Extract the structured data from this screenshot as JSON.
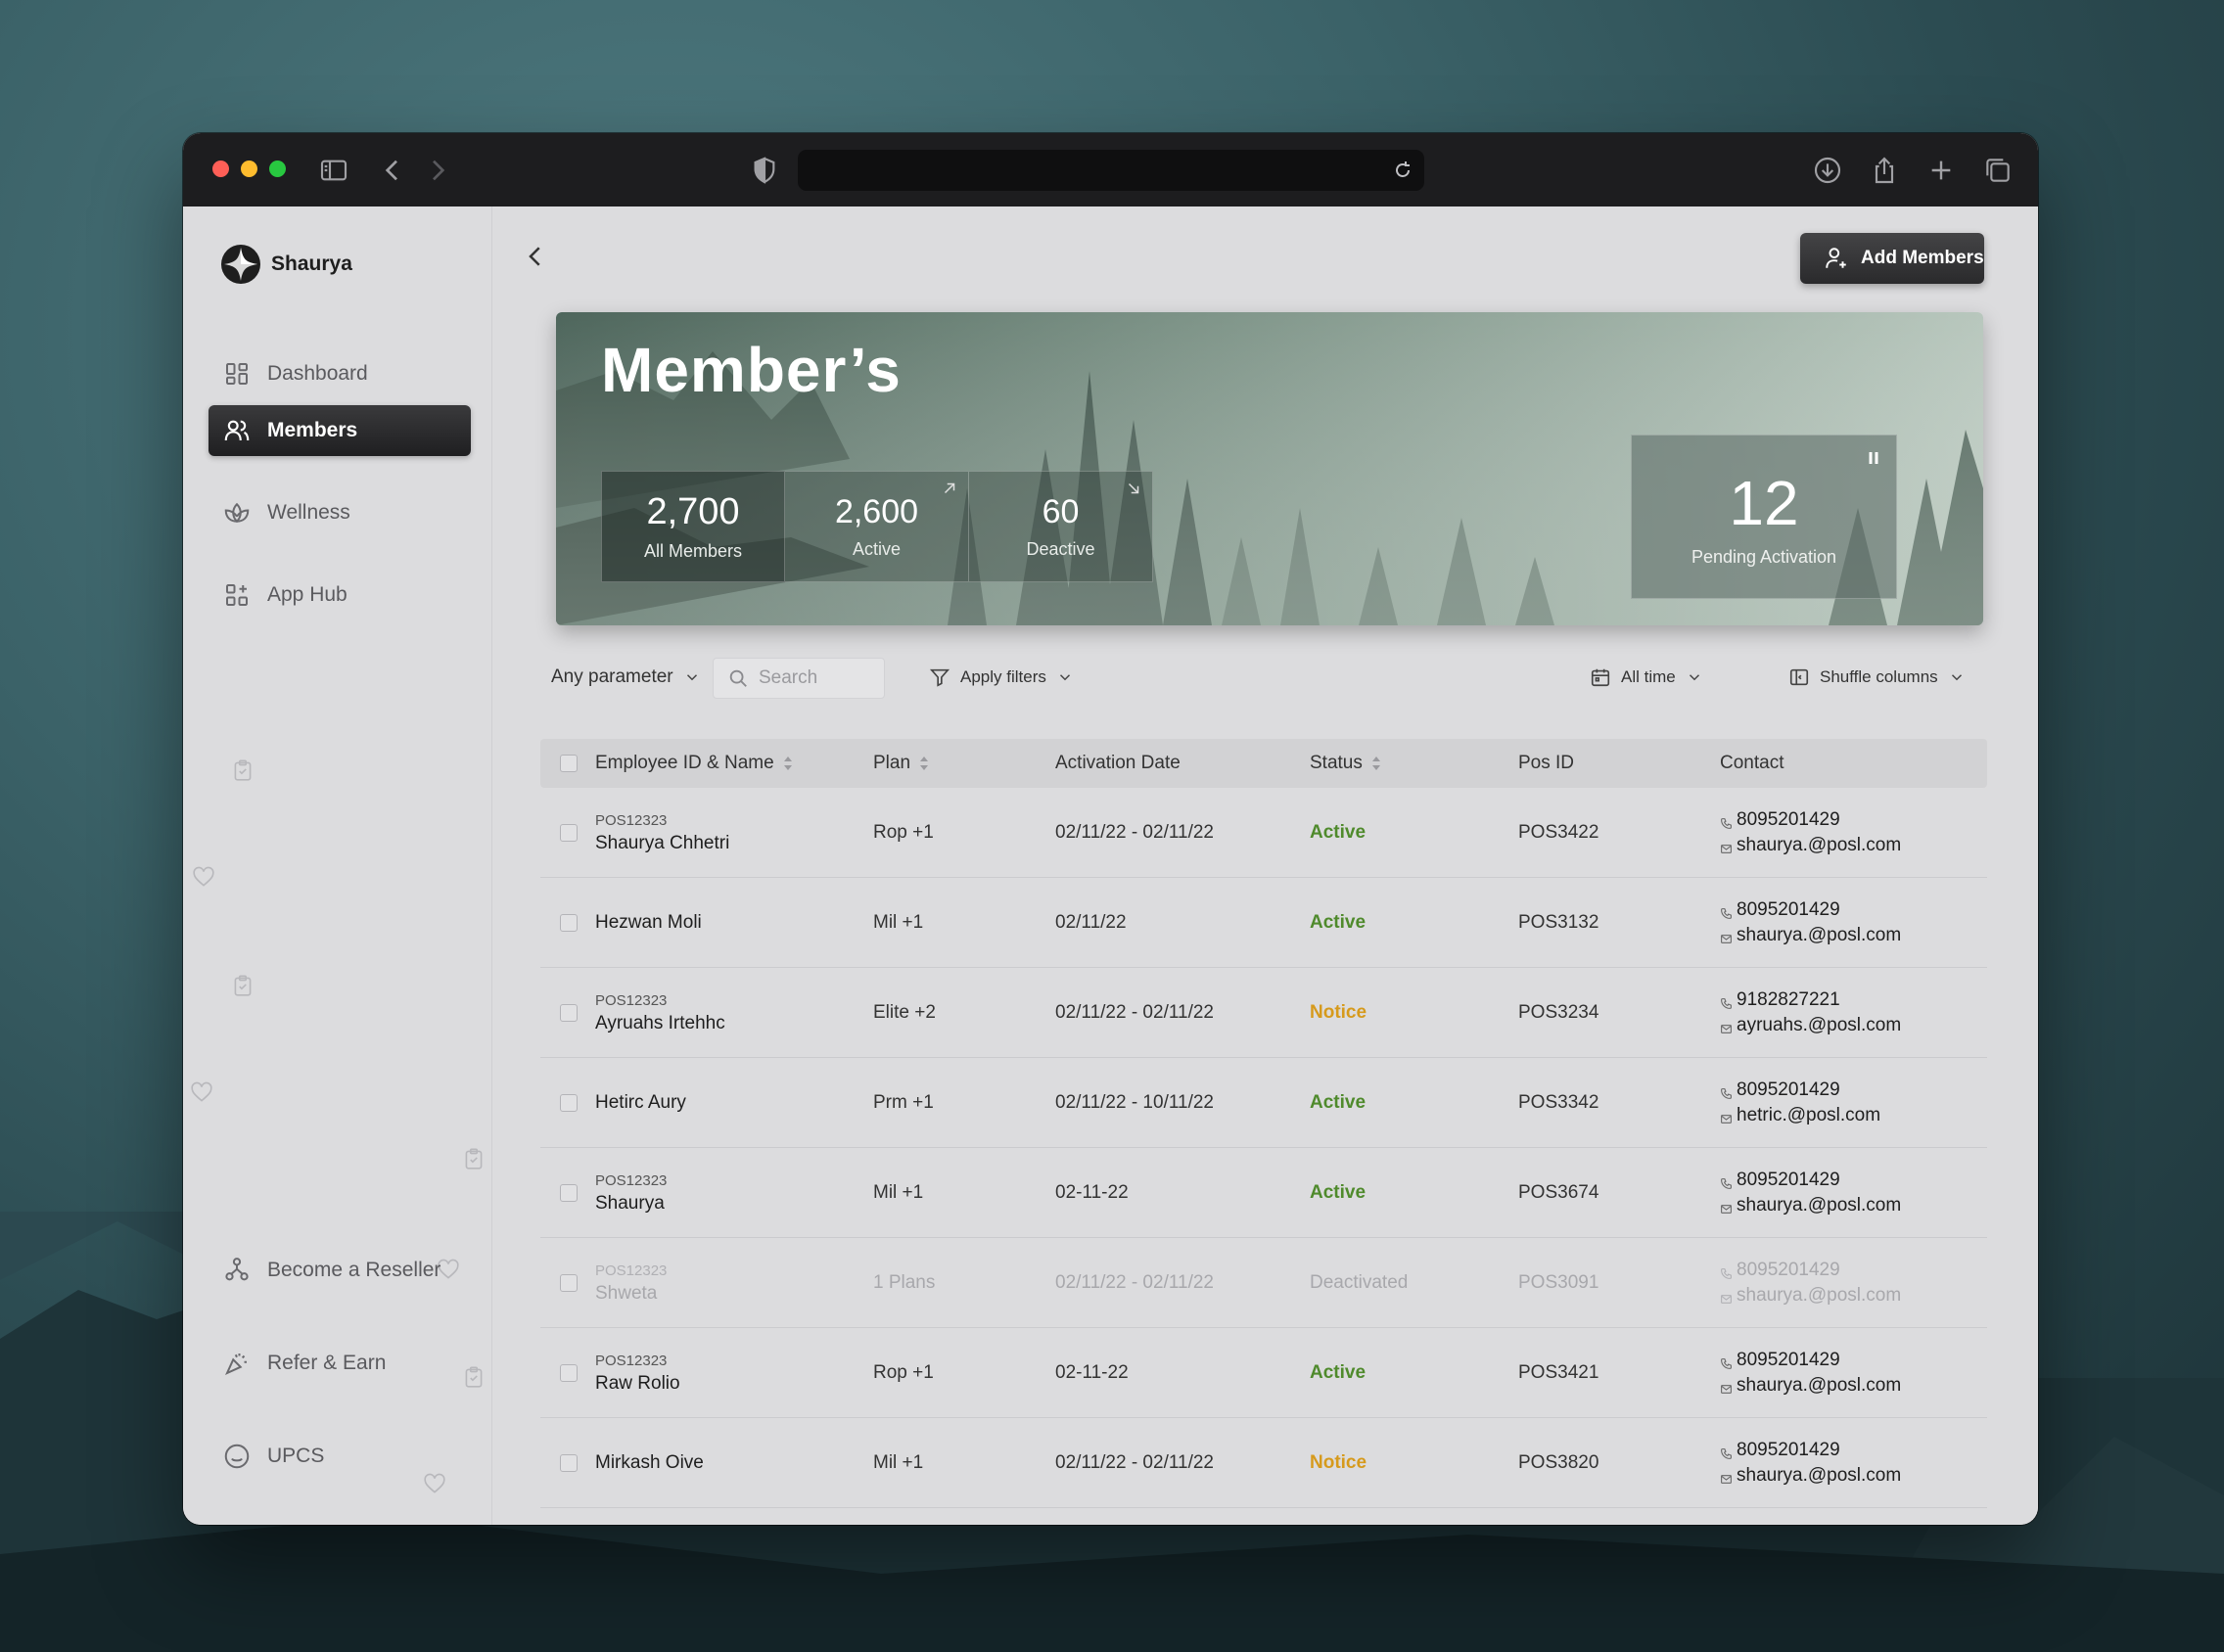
{
  "brand": {
    "name": "Shaurya"
  },
  "sidebar": {
    "items": [
      {
        "label": "Dashboard",
        "icon": "dashboard-icon"
      },
      {
        "label": "Members",
        "icon": "members-icon",
        "active": true
      },
      {
        "label": "Wellness",
        "icon": "wellness-icon"
      },
      {
        "label": "App Hub",
        "icon": "app-hub-icon"
      }
    ],
    "footer_items": [
      {
        "label": "Become a Reseller",
        "icon": "reseller-icon"
      },
      {
        "label": "Refer & Earn",
        "icon": "refer-icon"
      },
      {
        "label": "UPCS",
        "icon": "upcs-icon"
      }
    ]
  },
  "header": {
    "add_label": "Add Members"
  },
  "banner": {
    "title": "Member’s",
    "stats": [
      {
        "value": "2,700",
        "label": "All Members"
      },
      {
        "value": "2,600",
        "label": "Active"
      },
      {
        "value": "60",
        "label": "Deactive"
      }
    ],
    "pending": {
      "value": "12",
      "label": "Pending Activation"
    }
  },
  "filters": {
    "parameter": "Any parameter",
    "search_placeholder": "Search",
    "apply": "Apply filters",
    "time": "All time",
    "shuffle": "Shuffle columns"
  },
  "table": {
    "columns": [
      "Employee ID & Name",
      "Plan",
      "Activation Date",
      "Status",
      "Pos ID",
      "Contact"
    ],
    "rows": [
      {
        "emp_id": "POS12323",
        "name": "Shaurya Chhetri",
        "plan": "Rop +1",
        "date": "02/11/22 - 02/11/22",
        "status": "Active",
        "pos": "POS3422",
        "phone": "8095201429",
        "email": "shaurya.@posl.com"
      },
      {
        "emp_id": "",
        "name": "Hezwan Moli",
        "plan": "Mil +1",
        "date": "02/11/22",
        "status": "Active",
        "pos": "POS3132",
        "phone": "8095201429",
        "email": "shaurya.@posl.com"
      },
      {
        "emp_id": "POS12323",
        "name": "Ayruahs Irtehhc",
        "plan": "Elite +2",
        "date": "02/11/22 - 02/11/22",
        "status": "Notice",
        "pos": "POS3234",
        "phone": "9182827221",
        "email": "ayruahs.@posl.com"
      },
      {
        "emp_id": "",
        "name": "Hetirc Aury",
        "plan": "Prm +1",
        "date": "02/11/22 - 10/11/22",
        "status": "Active",
        "pos": "POS3342",
        "phone": "8095201429",
        "email": "hetric.@posl.com"
      },
      {
        "emp_id": "POS12323",
        "name": "Shaurya",
        "plan": "Mil +1",
        "date": "02-11-22",
        "status": "Active",
        "pos": "POS3674",
        "phone": "8095201429",
        "email": "shaurya.@posl.com"
      },
      {
        "emp_id": "POS12323",
        "name": "Shweta",
        "plan": "1 Plans",
        "date": "02/11/22 - 02/11/22",
        "status": "Deactivated",
        "pos": "POS3091",
        "phone": "8095201429",
        "email": "shaurya.@posl.com"
      },
      {
        "emp_id": "POS12323",
        "name": "Raw Rolio",
        "plan": "Rop +1",
        "date": "02-11-22",
        "status": "Active",
        "pos": "POS3421",
        "phone": "8095201429",
        "email": "shaurya.@posl.com"
      },
      {
        "emp_id": "",
        "name": "Mirkash Oive",
        "plan": "Mil +1",
        "date": "02/11/22 - 02/11/22",
        "status": "Notice",
        "pos": "POS3820",
        "phone": "8095201429",
        "email": "shaurya.@posl.com"
      }
    ]
  },
  "colors": {
    "active": "#4f8a2c",
    "notice": "#d69a1c",
    "deactivated": "#a8a8ac"
  }
}
